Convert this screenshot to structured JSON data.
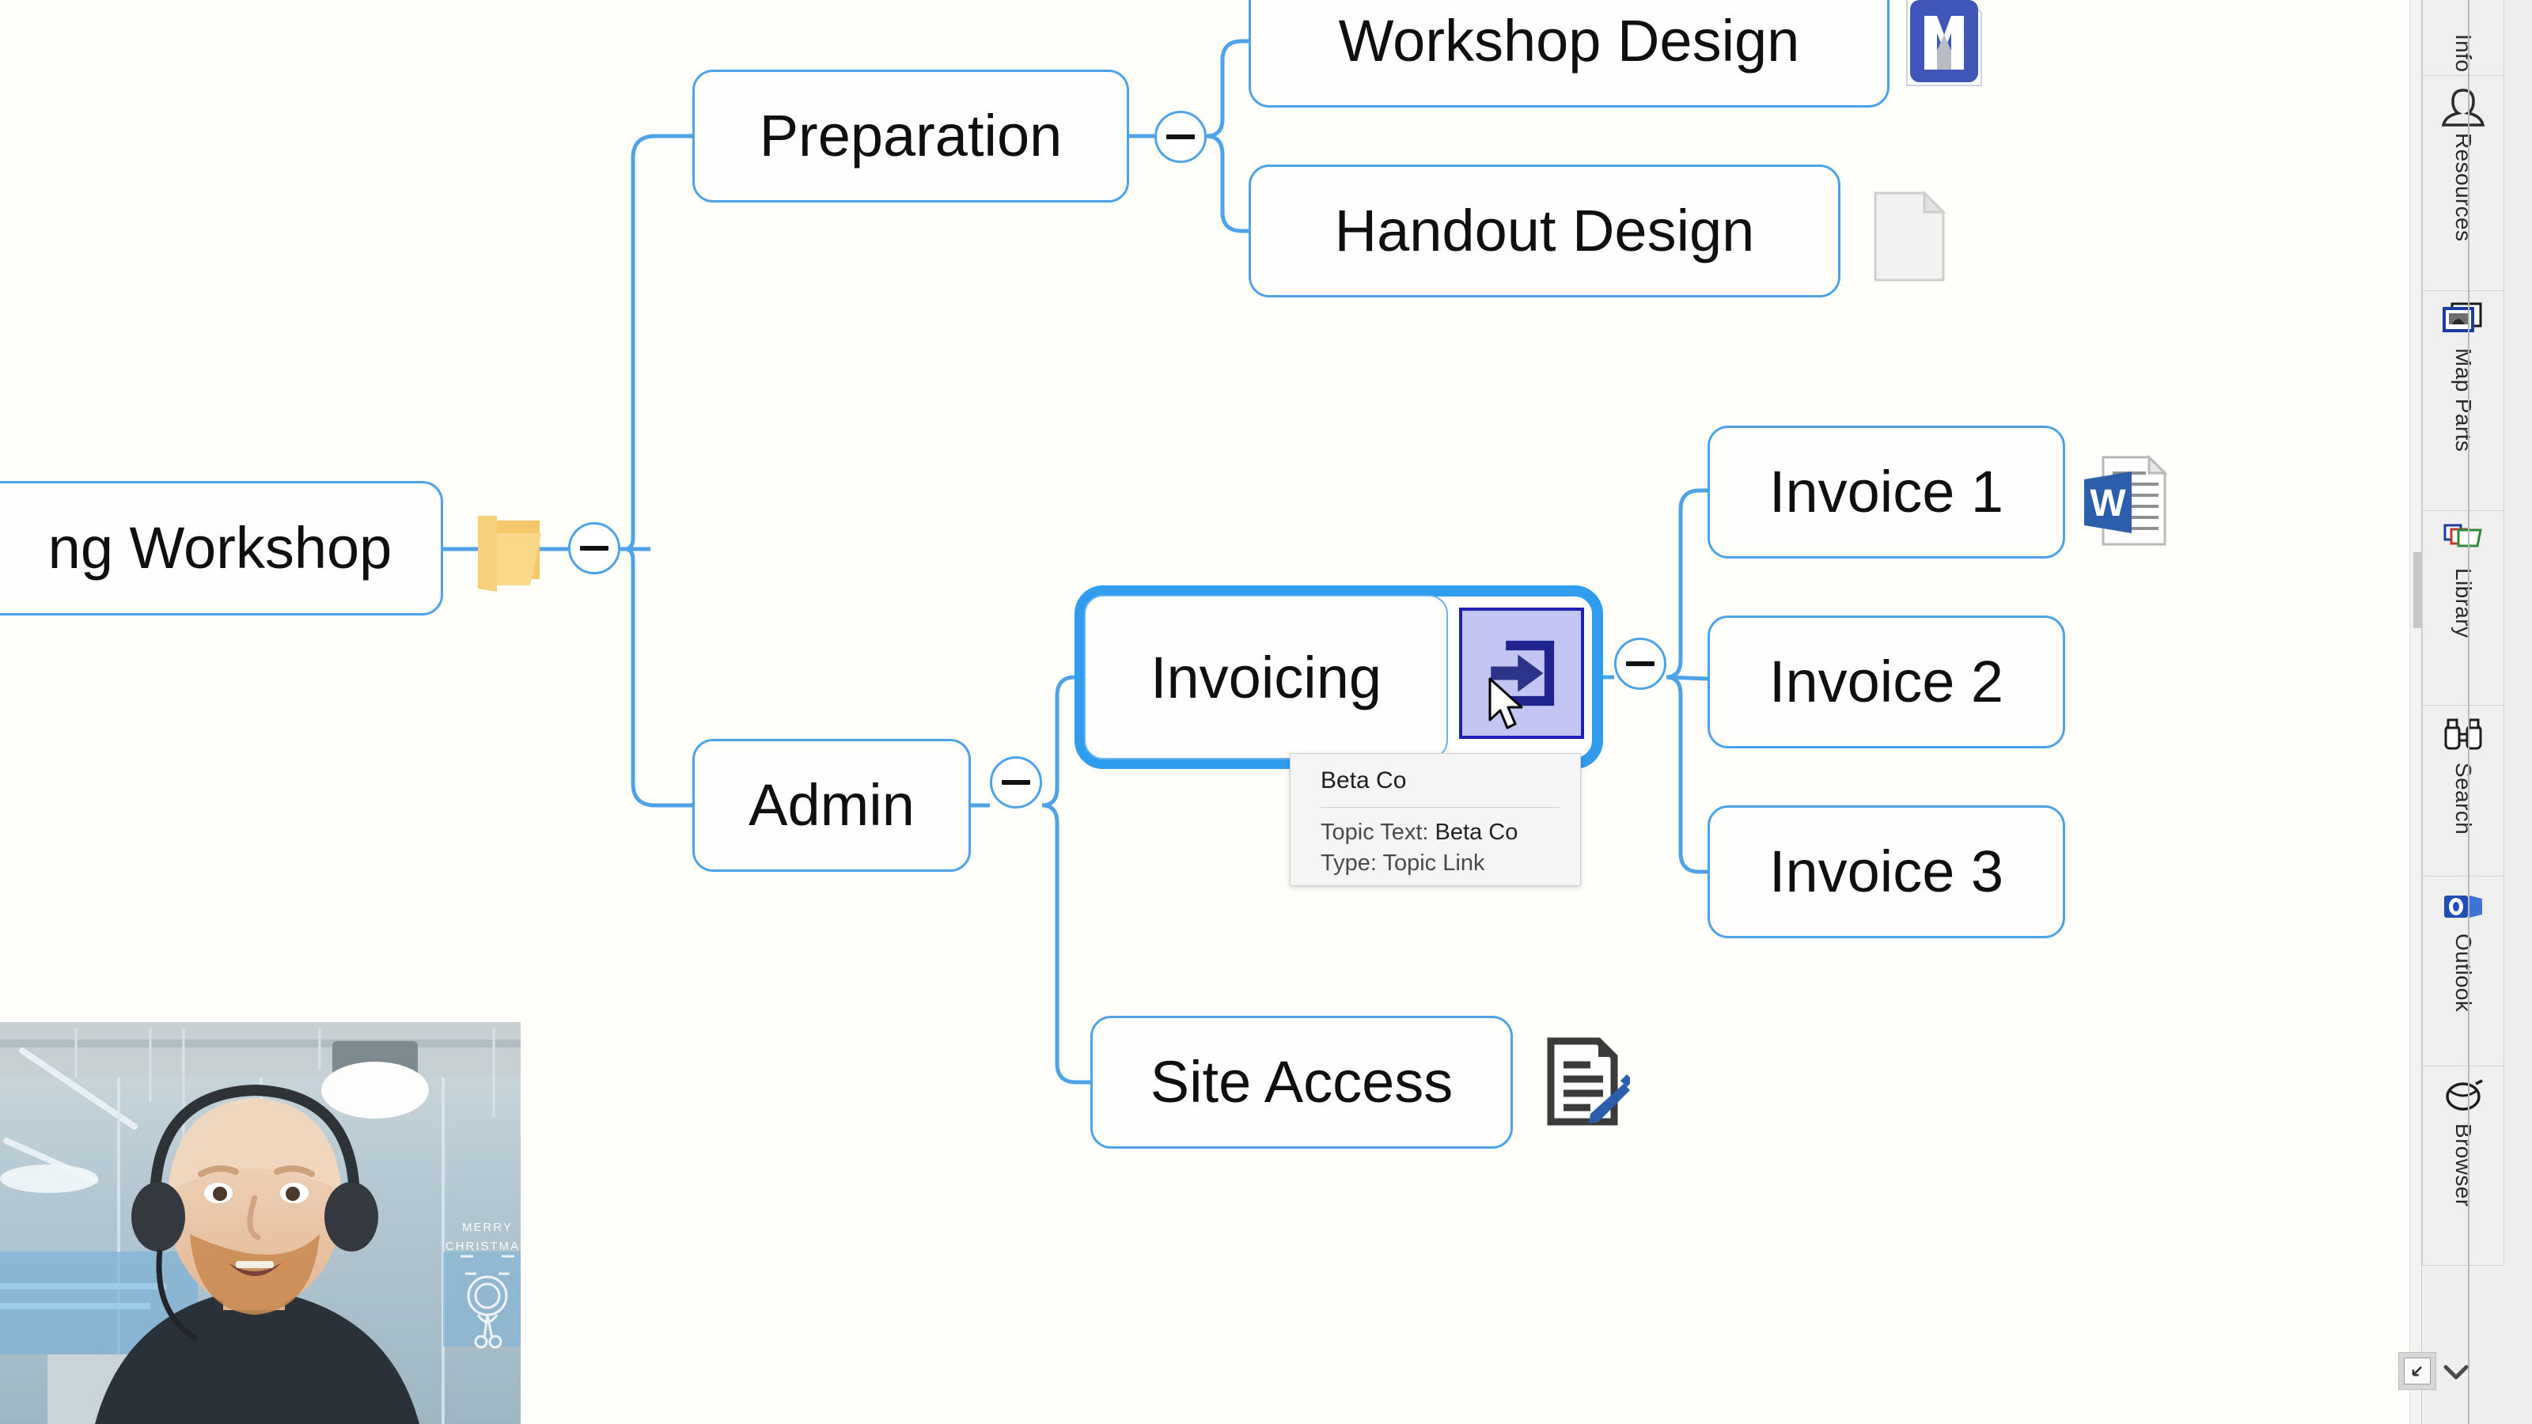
{
  "app": {
    "background": "#fffefb",
    "accent": "#4ea3e8",
    "selection": "#2f9ced",
    "link_highlight": "#c3c6f2",
    "link_border": "#2020b4"
  },
  "mindmap": {
    "nodes": [
      {
        "id": "root",
        "label": "ng Workshop",
        "icon": "open-folder-icon",
        "collapsed": false,
        "collapse_label": "−"
      },
      {
        "id": "prep",
        "label": "Preparation",
        "icon": null,
        "collapsed": false,
        "collapse_label": "−"
      },
      {
        "id": "workshop",
        "label": "Workshop Design",
        "icon": "mindmanager-file-icon",
        "collapsed": false
      },
      {
        "id": "handout",
        "label": "Handout Design",
        "icon": "blank-document-icon",
        "collapsed": false
      },
      {
        "id": "admin",
        "label": "Admin",
        "icon": null,
        "collapsed": false,
        "collapse_label": "−"
      },
      {
        "id": "invoicing",
        "label": "Invoicing",
        "icon": "topic-link-icon",
        "collapsed": false,
        "collapse_label": "−",
        "selected": true
      },
      {
        "id": "invoice1",
        "label": "Invoice 1",
        "icon": "word-document-icon"
      },
      {
        "id": "invoice2",
        "label": "Invoice 2",
        "icon": null
      },
      {
        "id": "invoice3",
        "label": "Invoice 3",
        "icon": null
      },
      {
        "id": "site",
        "label": "Site Access",
        "icon": "notes-edit-icon"
      }
    ]
  },
  "tooltip": {
    "title": "Beta Co",
    "rows": [
      {
        "label": "Topic Text:",
        "value": "Beta Co"
      },
      {
        "label": "Type:",
        "value": "Topic Link"
      }
    ]
  },
  "right_panel": {
    "tabs": [
      {
        "id": "info",
        "label": "Info",
        "icon": "info-icon"
      },
      {
        "id": "resources",
        "label": "Resources",
        "icon": "person-icon"
      },
      {
        "id": "mapparts",
        "label": "Map Parts",
        "icon": "map-parts-icon"
      },
      {
        "id": "library",
        "label": "Library",
        "icon": "library-icon"
      },
      {
        "id": "search",
        "label": "Search",
        "icon": "binoculars-icon"
      },
      {
        "id": "outlook",
        "label": "Outlook",
        "icon": "outlook-icon"
      },
      {
        "id": "browser",
        "label": "Browser",
        "icon": "browser-icon"
      }
    ],
    "restore_button": "restore-window-icon",
    "chevron": "chevron-down-icon"
  },
  "webcam": {
    "present": true,
    "overlay_text_1": "MERRY",
    "overlay_text_2": "CHRISTMAS"
  }
}
